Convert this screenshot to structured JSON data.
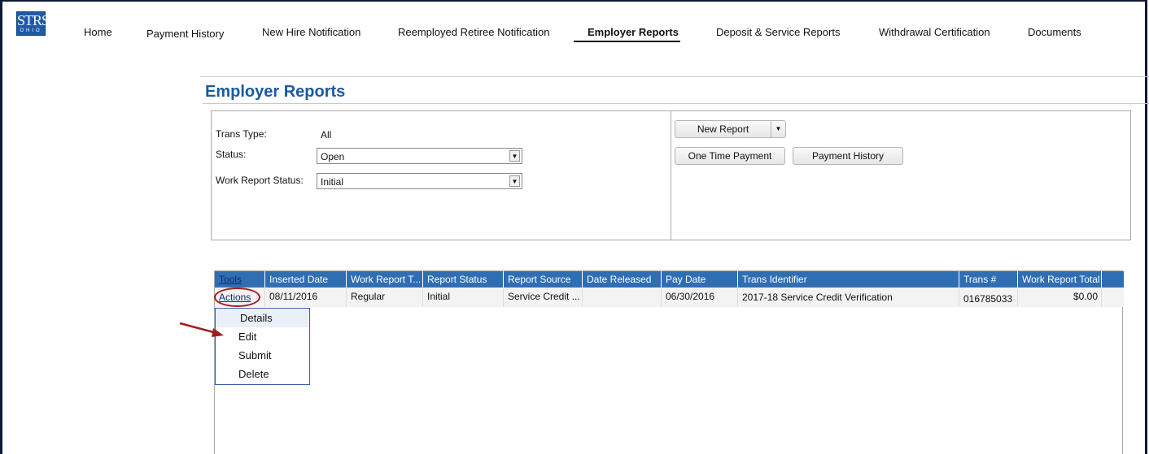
{
  "logo": {
    "big": "STRS",
    "small": "OHIO"
  },
  "nav": {
    "items": [
      {
        "label": "Home"
      },
      {
        "label": "Payment History"
      },
      {
        "label": "New Hire Notification"
      },
      {
        "label": "Reemployed Retiree Notification"
      },
      {
        "label": "Employer Reports",
        "active": true
      },
      {
        "label": "Deposit & Service Reports"
      },
      {
        "label": "Withdrawal Certification"
      },
      {
        "label": "Documents"
      }
    ]
  },
  "page": {
    "title": "Employer Reports"
  },
  "filters": {
    "trans_type_label": "Trans Type:",
    "trans_type_value": "All",
    "status_label": "Status:",
    "status_value": "Open",
    "work_report_status_label": "Work Report Status:",
    "work_report_status_value": "Initial"
  },
  "actions": {
    "new_report": "New Report",
    "one_time_payment": "One Time Payment",
    "payment_history": "Payment History"
  },
  "grid": {
    "headers": [
      "Tools",
      "Inserted Date",
      "Work Report T...",
      "Report Status",
      "Report Source",
      "Date Released",
      "Pay Date",
      "Trans Identifier",
      "Trans #",
      "Work Report Total"
    ],
    "row": {
      "tools": "Actions",
      "inserted_date": "08/11/2016",
      "work_report_type": "Regular",
      "report_status": "Initial",
      "report_source": "Service Credit ...",
      "date_released": "",
      "pay_date": "06/30/2016",
      "trans_identifier": "2017-18 Service Credit Verification",
      "trans_num": "016785033",
      "work_report_total": "$0.00"
    }
  },
  "context_menu": {
    "items": [
      "Details",
      "Edit",
      "Submit",
      "Delete"
    ]
  },
  "colors": {
    "brand_blue": "#1b5aa1",
    "grid_header": "#2f6eb3",
    "annotation_red": "#a01e1e"
  }
}
